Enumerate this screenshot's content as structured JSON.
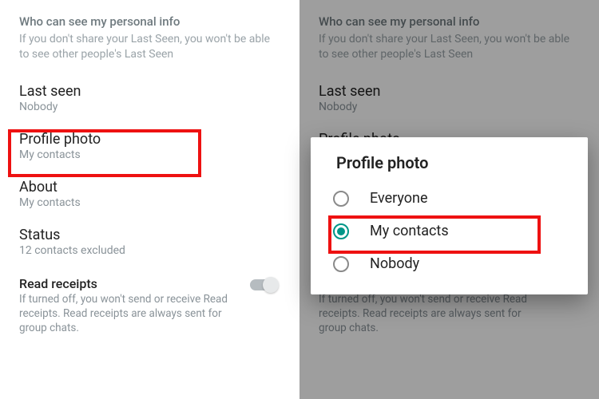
{
  "header": {
    "title": "Who can see my personal info",
    "subtitle": "If you don't share your Last Seen, you won't be able to see other people's Last Seen"
  },
  "items": {
    "last_seen": {
      "title": "Last seen",
      "value": "Nobody"
    },
    "profile": {
      "title": "Profile photo",
      "value": "My contacts"
    },
    "about": {
      "title": "About",
      "value": "My contacts"
    },
    "status": {
      "title": "Status",
      "value": "12 contacts excluded"
    },
    "read": {
      "title": "Read receipts",
      "value": "If turned off, you won't send or receive Read receipts. Read receipts are always sent for group chats."
    }
  },
  "dialog": {
    "title": "Profile photo",
    "options": {
      "everyone": "Everyone",
      "mycontacts": "My contacts",
      "nobody": "Nobody"
    }
  }
}
